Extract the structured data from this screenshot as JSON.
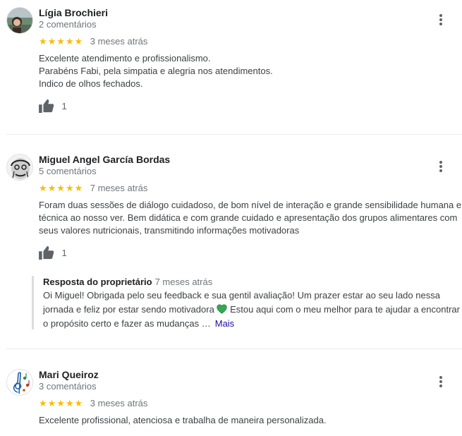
{
  "reviews": [
    {
      "name": "Lígia Brochieri",
      "reviews_count": "2 comentários",
      "stars": "★★★★★",
      "rating": 5,
      "time": "3 meses atrás",
      "lines": [
        "Excelente atendimento e profissionalismo.",
        "Parabéns Fabi, pela simpatia e alegria nos atendimentos.",
        "Indico de olhos fechados."
      ],
      "likes": "1"
    },
    {
      "name": "Miguel Angel García Bordas",
      "reviews_count": "5 comentários",
      "stars": "★★★★★",
      "rating": 5,
      "time": "7 meses atrás",
      "text": "Foram duas sessões de diálogo cuidadoso, de bom nível de interação e grande sensibilidade humana e técnica ao nosso ver. Bem didática e com grande cuidado e apresentação dos grupos alimentares com seus valores nutricionais, transmitindo informações motivadoras",
      "likes": "1",
      "owner_response": {
        "title": "Resposta do proprietário",
        "time": "7 meses atrás",
        "text_before": "Oi Miguel! Obrigada pelo seu feedback e sua gentil avaliação! Um prazer estar ao seu lado nessa jornada e feliz por estar sendo motivadora",
        "text_after": "Estou aqui com o meu melhor para te ajudar a encontrar o propósito certo e fazer as mudanças …",
        "more": "Mais",
        "emoji": "green-heart-icon"
      }
    },
    {
      "name": "Mari Queiroz",
      "reviews_count": "3 comentários",
      "stars": "★★★★★",
      "rating": 5,
      "time": "3 meses atrás",
      "text": "Excelente profissional, atenciosa e trabalha de maneira personalizada."
    }
  ],
  "colors": {
    "star": "#fbbc04",
    "link": "#1a0dab",
    "heart": "#34a853"
  },
  "icons": {
    "like": "thumbs-up-icon",
    "menu": "more-vert-icon"
  }
}
